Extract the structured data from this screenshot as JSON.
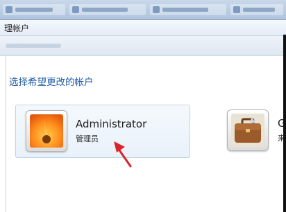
{
  "window": {
    "crumb_label": "理帐户"
  },
  "main": {
    "heading": "选择希望更改的帐户",
    "accounts": [
      {
        "name": "Administrator",
        "role": "管理员",
        "icon": "flower-avatar-icon"
      },
      {
        "name": "G",
        "role": "来",
        "icon": "briefcase-avatar-icon"
      }
    ]
  },
  "annotation": {
    "icon": "red-arrow-icon",
    "color": "#d9252a"
  }
}
